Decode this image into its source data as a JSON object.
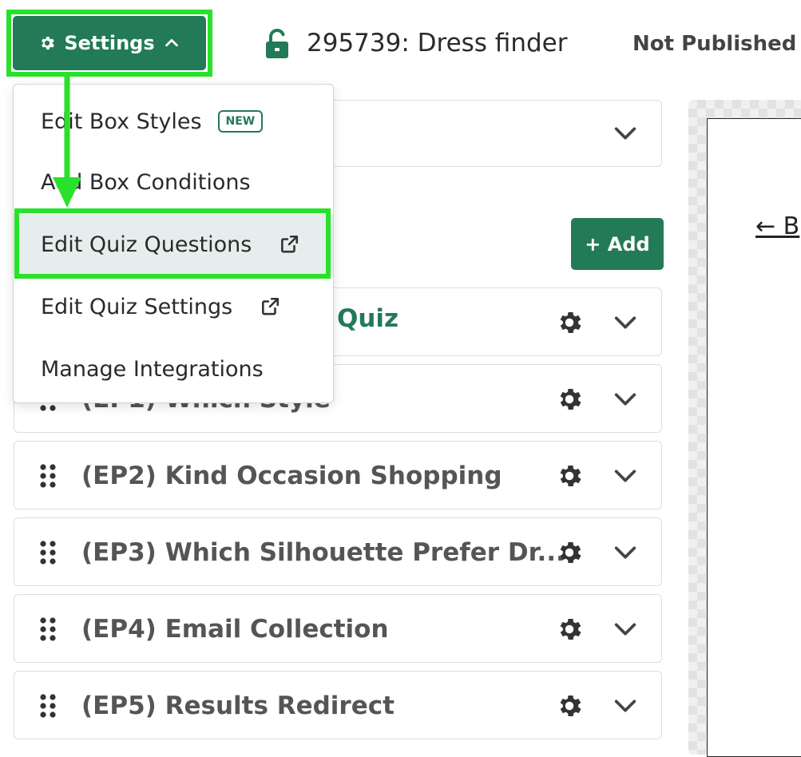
{
  "header": {
    "settings_label": "Settings",
    "page_title": "295739: Dress finder",
    "status": "Not Published"
  },
  "panel": {
    "add_label": "+ Add",
    "partial_row_text": "Quiz",
    "rows": [
      {
        "label": "(EP1) Which Style"
      },
      {
        "label": "(EP2) Kind Occasion Shopping"
      },
      {
        "label": "(EP3) Which Silhouette Prefer Dr..."
      },
      {
        "label": "(EP4) Email Collection"
      },
      {
        "label": "(EP5) Results Redirect"
      }
    ]
  },
  "preview": {
    "back_link": "← B"
  },
  "settings_menu": {
    "items": [
      {
        "label": "Edit Box Styles",
        "badge": "NEW"
      },
      {
        "label": "Add Box Conditions"
      },
      {
        "label": "Edit Quiz Questions",
        "icon": "external-link-icon"
      },
      {
        "label": "Edit Quiz Settings",
        "icon": "external-link-icon"
      },
      {
        "label": "Manage Integrations"
      }
    ]
  },
  "colors": {
    "brand": "#237a57",
    "highlight": "#29e12b"
  }
}
